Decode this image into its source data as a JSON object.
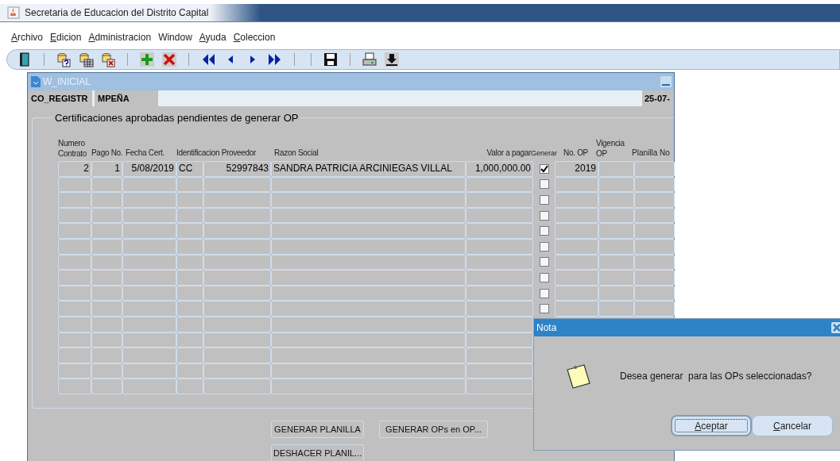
{
  "window": {
    "title": "Secretaria de Educacion del Distrito Capital"
  },
  "menu": [
    {
      "label": "Archivo",
      "underline_first": true
    },
    {
      "label": "Edicion",
      "underline_first": true
    },
    {
      "label": "Administracion",
      "underline_first": true
    },
    {
      "label": "Window",
      "underline_first": false
    },
    {
      "label": "Ayuda",
      "underline_first": true
    },
    {
      "label": "Coleccion",
      "underline_first": true
    }
  ],
  "form": {
    "title": "W_INICIAL",
    "info": [
      "CO_REGISTR",
      "MPEÑA"
    ],
    "date": "25-07-",
    "group_title": "Certificaciones aprobadas pendientes de generar OP",
    "columns": [
      "Numero Contrato",
      "Pago No.",
      "Fecha Cert.",
      "Identificacion Proveedor",
      "Razon Social",
      "Valor a pagar",
      "Generar",
      "No. OP",
      "Vigencia OP",
      "Planilla No"
    ],
    "rows": [
      {
        "cells": [
          "2",
          "1",
          "5/08/2019",
          "CC",
          "52997843",
          "SANDRA PATRICIA ARCINIEGAS VILLAL",
          "1,000,000.00",
          "",
          "2019",
          ""
        ],
        "checked": true
      },
      {
        "checked": false
      },
      {
        "checked": false
      },
      {
        "checked": false
      },
      {
        "checked": false
      },
      {
        "checked": false
      },
      {
        "checked": false
      },
      {
        "checked": false
      },
      {
        "checked": false
      },
      {
        "checked": false
      }
    ],
    "buttons": [
      "GENERAR PLANILLA",
      "GENERAR OPs en OP...",
      "DESHACER PLANIL..."
    ]
  },
  "dialog": {
    "title": "Nota",
    "message": "Desea generar  para las OPs seleccionadas?",
    "buttons": [
      {
        "label": "Aceptar",
        "focused": true
      },
      {
        "label": "Cancelar",
        "focused": false
      }
    ]
  }
}
